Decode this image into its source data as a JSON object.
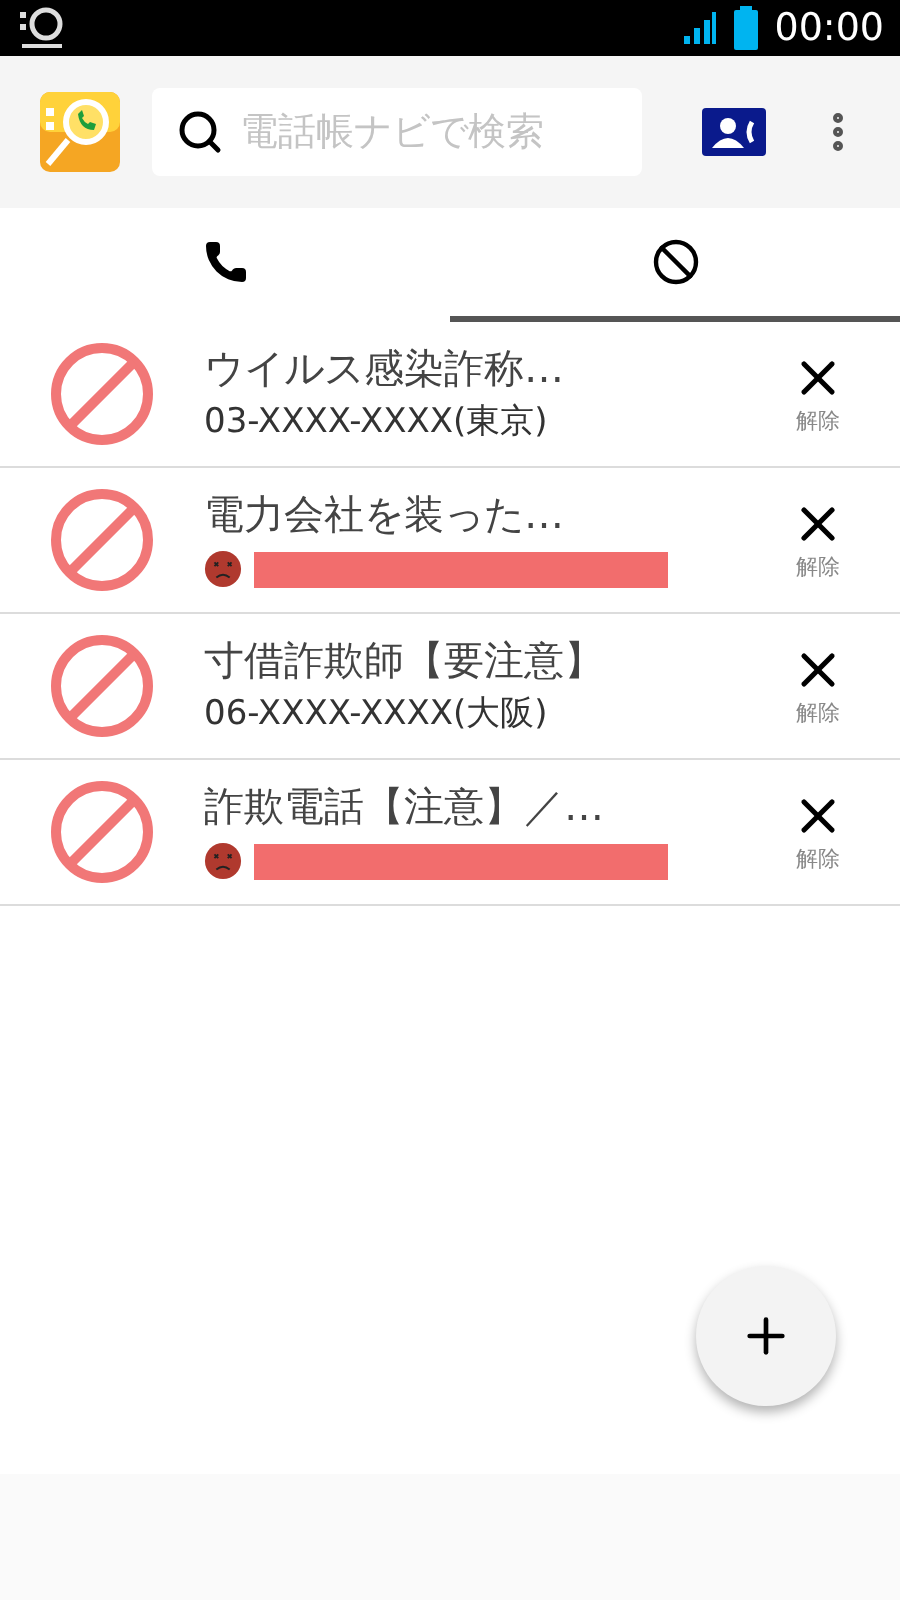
{
  "status_bar": {
    "time": "00:00"
  },
  "search": {
    "placeholder": "電話帳ナビで検索"
  },
  "tabs": [
    {
      "kind": "phone",
      "selected": false
    },
    {
      "kind": "block",
      "selected": true
    }
  ],
  "entries": [
    {
      "title": "ウイルス感染詐称…",
      "kind": "number",
      "number": "03-XXXX-XXXX(東京)",
      "action": "解除"
    },
    {
      "title": "電力会社を装った…",
      "kind": "redacted",
      "action": "解除"
    },
    {
      "title": "寸借詐欺師【要注意】",
      "kind": "number",
      "number": "06-XXXX-XXXX(大阪)",
      "action": "解除"
    },
    {
      "title": "詐欺電話【注意】／…",
      "kind": "redacted",
      "action": "解除"
    }
  ]
}
